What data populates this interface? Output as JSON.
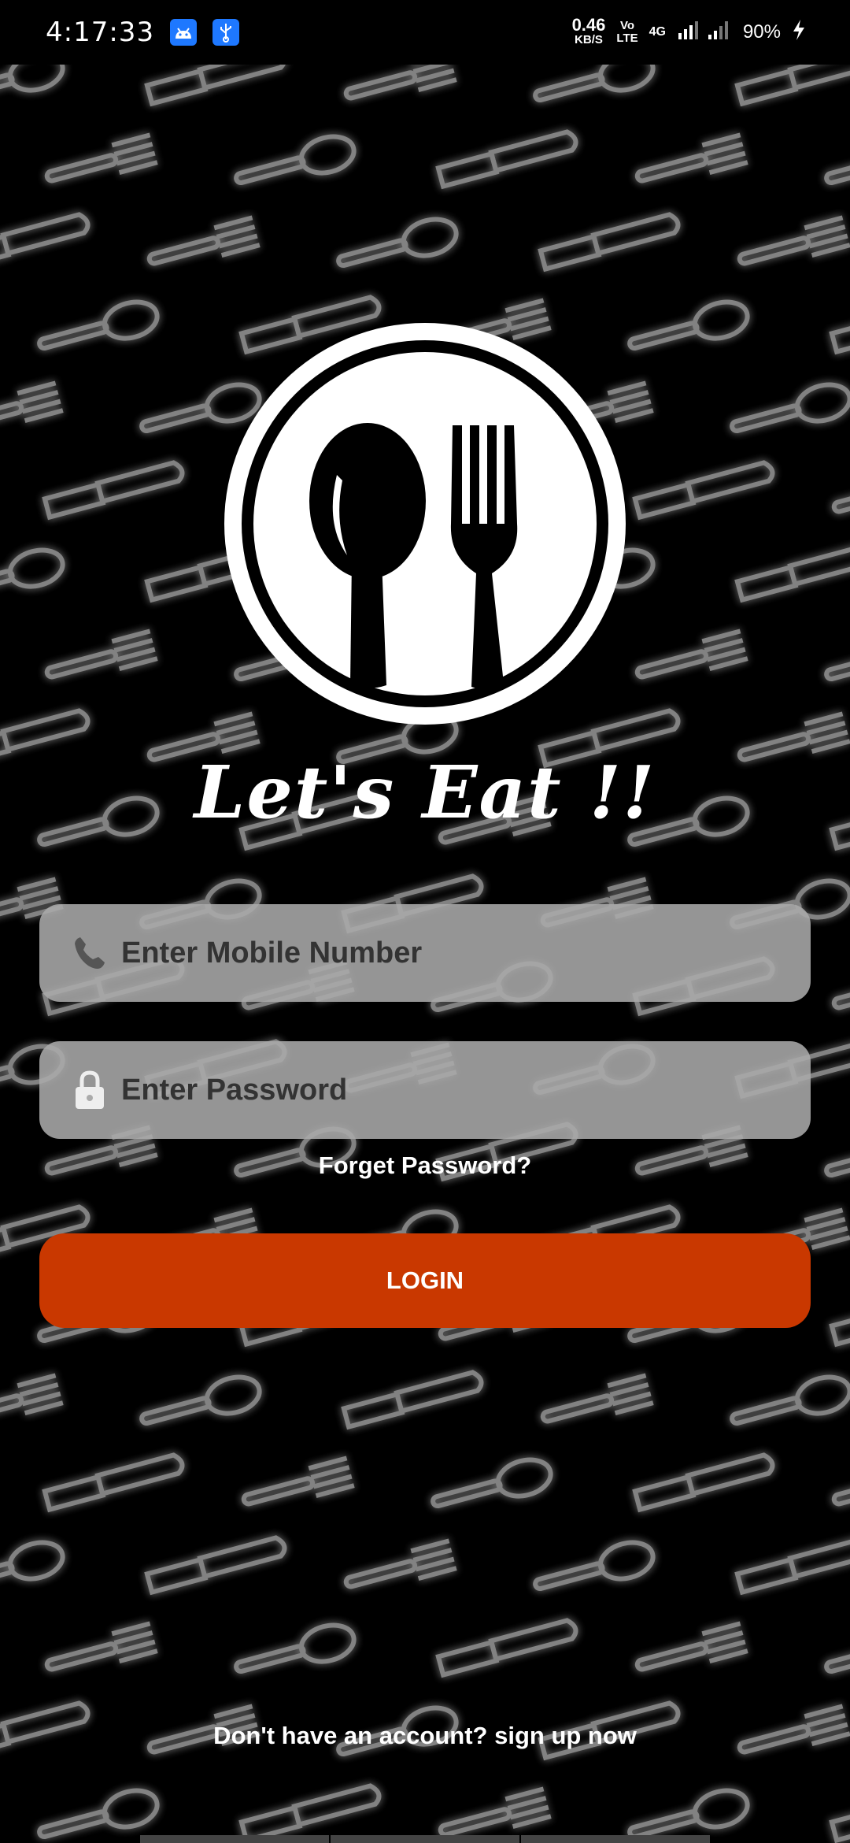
{
  "status_bar": {
    "time": "4:17:33",
    "speed_value": "0.46",
    "speed_unit": "KB/S",
    "volte_top": "Vo",
    "volte_bottom": "LTE",
    "network": "4G",
    "battery": "90%",
    "icons": [
      "android-icon",
      "usb-icon",
      "signal-icon",
      "charging-icon"
    ]
  },
  "app": {
    "title": "Let's Eat !!",
    "logo": "spoon-fork-plate-logo"
  },
  "form": {
    "mobile_placeholder": "Enter Mobile Number",
    "password_placeholder": "Enter Password",
    "forget_password": "Forget Password?",
    "login_label": "LOGIN",
    "signup_text": "Don't have an account? sign up now"
  },
  "colors": {
    "background": "#000000",
    "accent": "#c93800",
    "field": "#aaaaaa"
  }
}
